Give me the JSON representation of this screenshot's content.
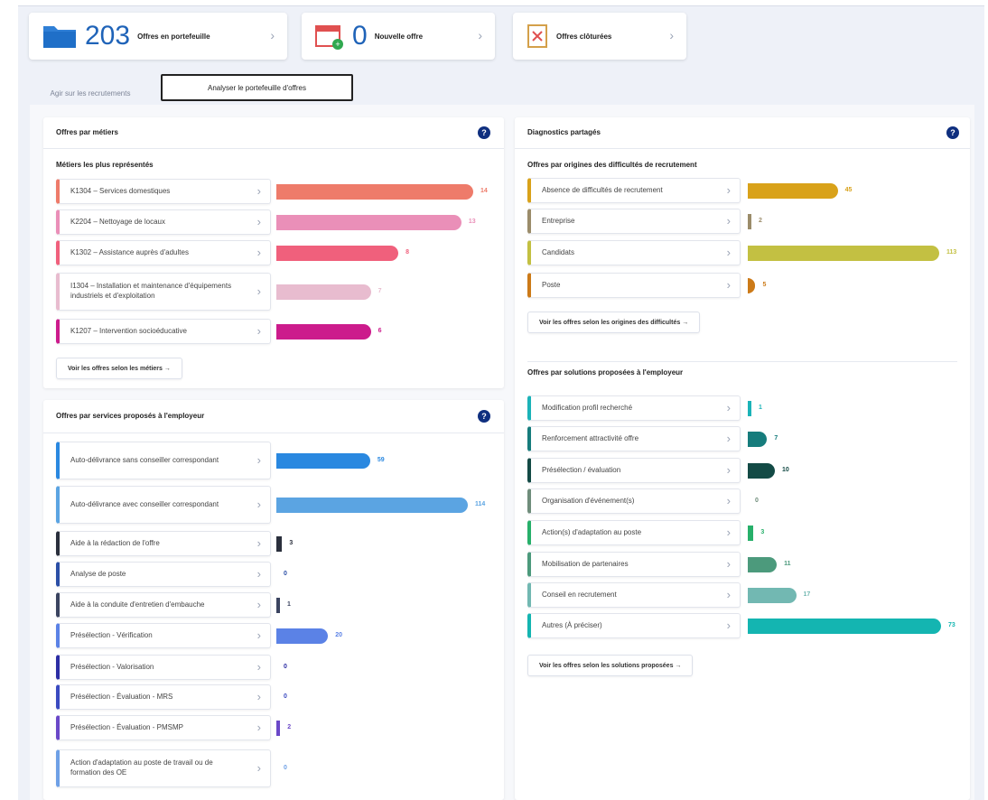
{
  "stats": [
    {
      "value": "203",
      "label": "Offres en portefeuille",
      "icon": "folder-icon"
    },
    {
      "value": "0",
      "label": "Nouvelle offre",
      "icon": "calendar-icon"
    },
    {
      "value": "",
      "label": "Offres clôturées",
      "icon": "closed-offer-icon"
    }
  ],
  "tabs": {
    "inactive": "Agir sur les recrutements",
    "active": "Analyser le portefeuille d'offres"
  },
  "metiers": {
    "title": "Offres par métiers",
    "subtitle": "Métiers les plus représentés",
    "link": "Voir les offres selon les métiers →",
    "rows": [
      {
        "label": "K1304 – Services domestiques",
        "value": 14,
        "display": "14",
        "color": "#ee7b6a",
        "frac": 1.0
      },
      {
        "label": "K2204 – Nettoyage de locaux",
        "value": 13,
        "display": "13",
        "color": "#ea8fb8",
        "frac": 0.94
      },
      {
        "label": "K1302 – Assistance auprès d'adultes",
        "value": 8,
        "display": "8",
        "color": "#f0607c",
        "frac": 0.62
      },
      {
        "label": "I1304 – Installation et maintenance d'équipements industriels et d'exploitation",
        "value": 7,
        "display": "7",
        "color": "#e8bccf",
        "frac": 0.48
      },
      {
        "label": "K1207 – Intervention socioéducative",
        "value": 6,
        "display": "6",
        "color": "#cc1b8c",
        "frac": 0.48
      }
    ]
  },
  "services": {
    "title": "Offres par services proposés à l'employeur",
    "rows": [
      {
        "label": "Auto-délivrance sans conseiller correspondant",
        "value": 59,
        "display": "59",
        "color": "#2a88e0",
        "frac": 0.49
      },
      {
        "label": "Auto-délivrance avec conseiller correspondant",
        "value": 114,
        "display": "114",
        "color": "#5ba4e2",
        "frac": 1.0
      },
      {
        "label": "Aide à la rédaction de l'offre",
        "value": 3,
        "display": "3",
        "color": "#2a2f3c",
        "frac": 0.03
      },
      {
        "label": "Analyse de poste",
        "value": 0,
        "display": "0",
        "color": "#2b4fa6",
        "frac": 0.0
      },
      {
        "label": "Aide à la conduite d'entretien d'embauche",
        "value": 1,
        "display": "1",
        "color": "#3b4460",
        "frac": 0.01
      },
      {
        "label": "Présélection - Vérification",
        "value": 20,
        "display": "20",
        "color": "#5b82e6",
        "frac": 0.27
      },
      {
        "label": "Présélection - Valorisation",
        "value": 0,
        "display": "0",
        "color": "#2c2da4",
        "frac": 0.0
      },
      {
        "label": "Présélection - Évaluation - MRS",
        "value": 0,
        "display": "0",
        "color": "#3a4ac0",
        "frac": 0.0
      },
      {
        "label": "Présélection - Évaluation - PMSMP",
        "value": 2,
        "display": "2",
        "color": "#6a48c8",
        "frac": 0.02
      },
      {
        "label": "Action d'adaptation au poste de travail ou de formation des OE",
        "value": 0,
        "display": "0",
        "color": "#6ea0e6",
        "frac": 0.0
      }
    ]
  },
  "diagnostics": {
    "title": "Diagnostics partagés",
    "origins_subtitle": "Offres par origines des difficultés de recrutement",
    "origins_link": "Voir les offres selon les origines des difficultés →",
    "origins": [
      {
        "label": "Absence de difficultés de recrutement",
        "value": 45,
        "display": "45",
        "color": "#d9a21a",
        "frac": 0.47
      },
      {
        "label": "Entreprise",
        "value": 2,
        "display": "2",
        "color": "#9b8c6a",
        "frac": 0.01
      },
      {
        "label": "Candidats",
        "value": 113,
        "display": "113",
        "color": "#c3c042",
        "frac": 1.0
      },
      {
        "label": "Poste",
        "value": 5,
        "display": "5",
        "color": "#cc7a18",
        "frac": 0.04
      }
    ],
    "solutions_subtitle": "Offres par solutions proposées à l'employeur",
    "solutions_link": "Voir les offres selon les solutions proposées →",
    "solutions": [
      {
        "label": "Modification profil recherché",
        "value": 1,
        "display": "1",
        "color": "#1bb3b8",
        "frac": 0.01
      },
      {
        "label": "Renforcement attractivité offre",
        "value": 7,
        "display": "7",
        "color": "#167c7c",
        "frac": 0.1
      },
      {
        "label": "Présélection / évaluation",
        "value": 10,
        "display": "10",
        "color": "#134a45",
        "frac": 0.14
      },
      {
        "label": "Organisation d'événement(s)",
        "value": 0,
        "display": "0",
        "color": "#6f8d7b",
        "frac": 0.0
      },
      {
        "label": "Action(s) d'adaptation au poste",
        "value": 3,
        "display": "3",
        "color": "#27b06a",
        "frac": 0.03
      },
      {
        "label": "Mobilisation de partenaires",
        "value": 11,
        "display": "11",
        "color": "#4c9a7c",
        "frac": 0.15
      },
      {
        "label": "Conseil en recrutement",
        "value": 17,
        "display": "17",
        "color": "#72b8b2",
        "frac": 0.25
      },
      {
        "label": "Autres (À préciser)",
        "value": 73,
        "display": "73",
        "color": "#14b5b1",
        "frac": 1.0
      }
    ]
  }
}
